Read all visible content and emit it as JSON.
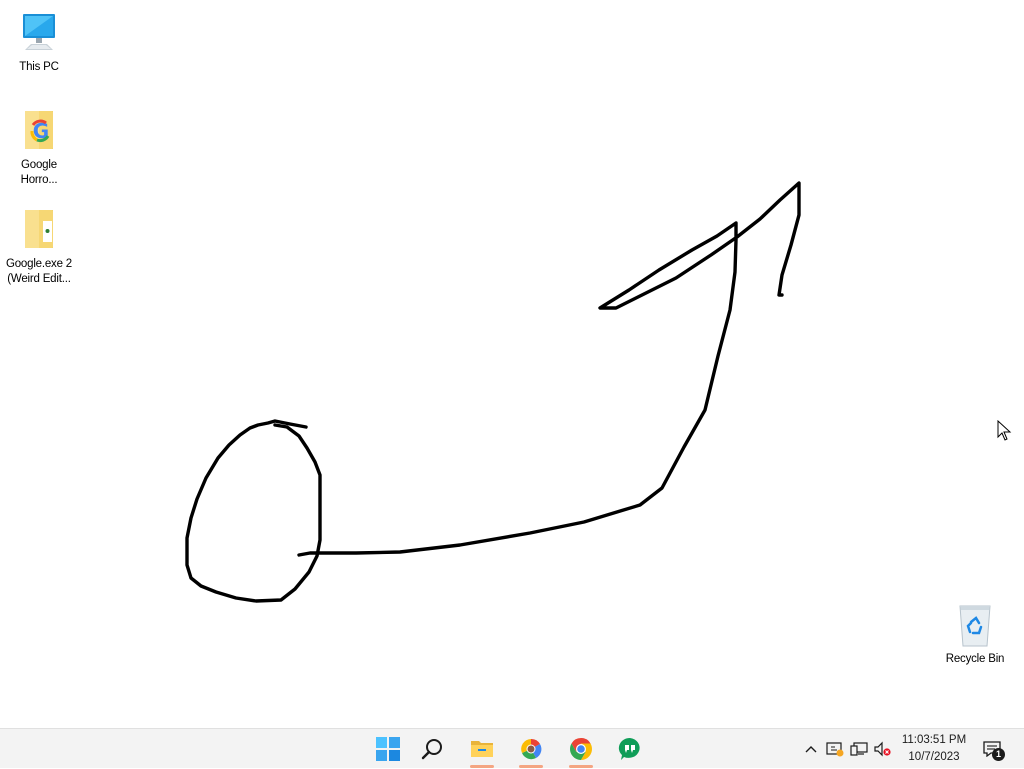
{
  "desktop": {
    "icons": [
      {
        "label": "This PC",
        "icon": "computer-icon"
      },
      {
        "label": "Google Horro...",
        "icon": "folder-google-icon"
      },
      {
        "label": "Google.exe 2 (Weird Edit...",
        "icon": "folder-icon"
      },
      {
        "label": "Recycle Bin",
        "icon": "recycle-bin-icon"
      }
    ]
  },
  "taskbar": {
    "items": [
      {
        "name": "start",
        "icon": "windows-start-icon"
      },
      {
        "name": "search",
        "icon": "search-icon"
      },
      {
        "name": "file-explorer",
        "icon": "file-explorer-icon"
      },
      {
        "name": "google-app",
        "icon": "google-app-icon"
      },
      {
        "name": "chrome",
        "icon": "chrome-icon"
      },
      {
        "name": "chat-app",
        "icon": "chat-app-icon"
      }
    ],
    "running_indicator_color": "#f4a582",
    "tray": {
      "icons": [
        "chevron-up-icon",
        "security-alert-icon",
        "network-icon",
        "volume-muted-icon"
      ],
      "time": "11:03:51 PM",
      "date": "10/7/2023",
      "notification_count": "1"
    }
  },
  "colors": {
    "desktop_bg": "#ffffff",
    "taskbar_bg": "#f3f3f3",
    "folder": "#f6d774",
    "accent": "#0078d4"
  }
}
